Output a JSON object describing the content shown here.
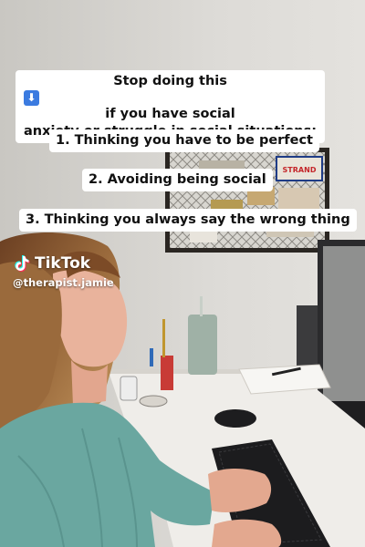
{
  "caption": {
    "title_line1": "Stop doing this",
    "title_arrow": "⬇",
    "title_line1_suffix": "if you have social",
    "title_line2": "anxiety or struggle in social situations:",
    "items": [
      "1. Thinking you have to be perfect",
      "2. Avoiding being social",
      "3. Thinking you always say the wrong thing"
    ]
  },
  "overlay": {
    "brand": "TikTok",
    "handle": "@therapist.jamie"
  },
  "scene": {
    "board_sticker": "STRAND"
  },
  "colors": {
    "wall": "#d9d7d3",
    "sweater": "#6aa7a0",
    "hair": "#8a5a32",
    "emoji_blue": "#3b7be0"
  }
}
